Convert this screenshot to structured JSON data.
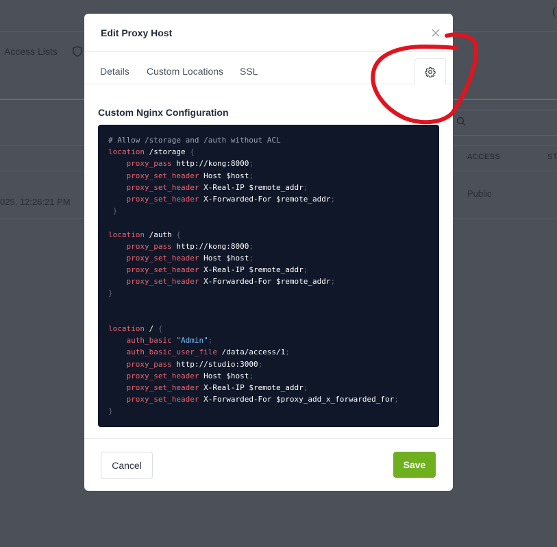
{
  "background": {
    "nav_item": "Access Lists",
    "table_headers": [
      "ACCESS",
      "ST"
    ],
    "row": {
      "date": "025, 12:26:21 PM",
      "access": "Public"
    }
  },
  "modal": {
    "title": "Edit Proxy Host",
    "tabs": [
      {
        "label": "Details"
      },
      {
        "label": "Custom Locations"
      },
      {
        "label": "SSL"
      }
    ],
    "gear_tab_icon": "gear-icon",
    "section_label": "Custom Nginx Configuration",
    "config_lines": [
      "# Allow /storage and /auth without ACL",
      "location /storage {",
      "    proxy_pass http://kong:8000;",
      "    proxy_set_header Host $host;",
      "    proxy_set_header X-Real-IP $remote_addr;",
      "    proxy_set_header X-Forwarded-For $remote_addr;",
      " }",
      "",
      "location /auth {",
      "    proxy_pass http://kong:8000;",
      "    proxy_set_header Host $host;",
      "    proxy_set_header X-Real-IP $remote_addr;",
      "    proxy_set_header X-Forwarded-For $remote_addr;",
      "}",
      "",
      "",
      "location / {",
      "    auth_basic \"Admin\";",
      "    auth_basic_user_file /data/access/1;",
      "    proxy_pass http://studio:3000;",
      "    proxy_set_header Host $host;",
      "    proxy_set_header X-Real-IP $remote_addr;",
      "    proxy_set_header X-Forwarded-For $proxy_add_x_forwarded_for;",
      "}"
    ],
    "buttons": {
      "cancel": "Cancel",
      "save": "Save"
    }
  },
  "colors": {
    "save_button": "#6eb01e",
    "code_background": "#0f1729",
    "annotation": "#e0141e"
  }
}
